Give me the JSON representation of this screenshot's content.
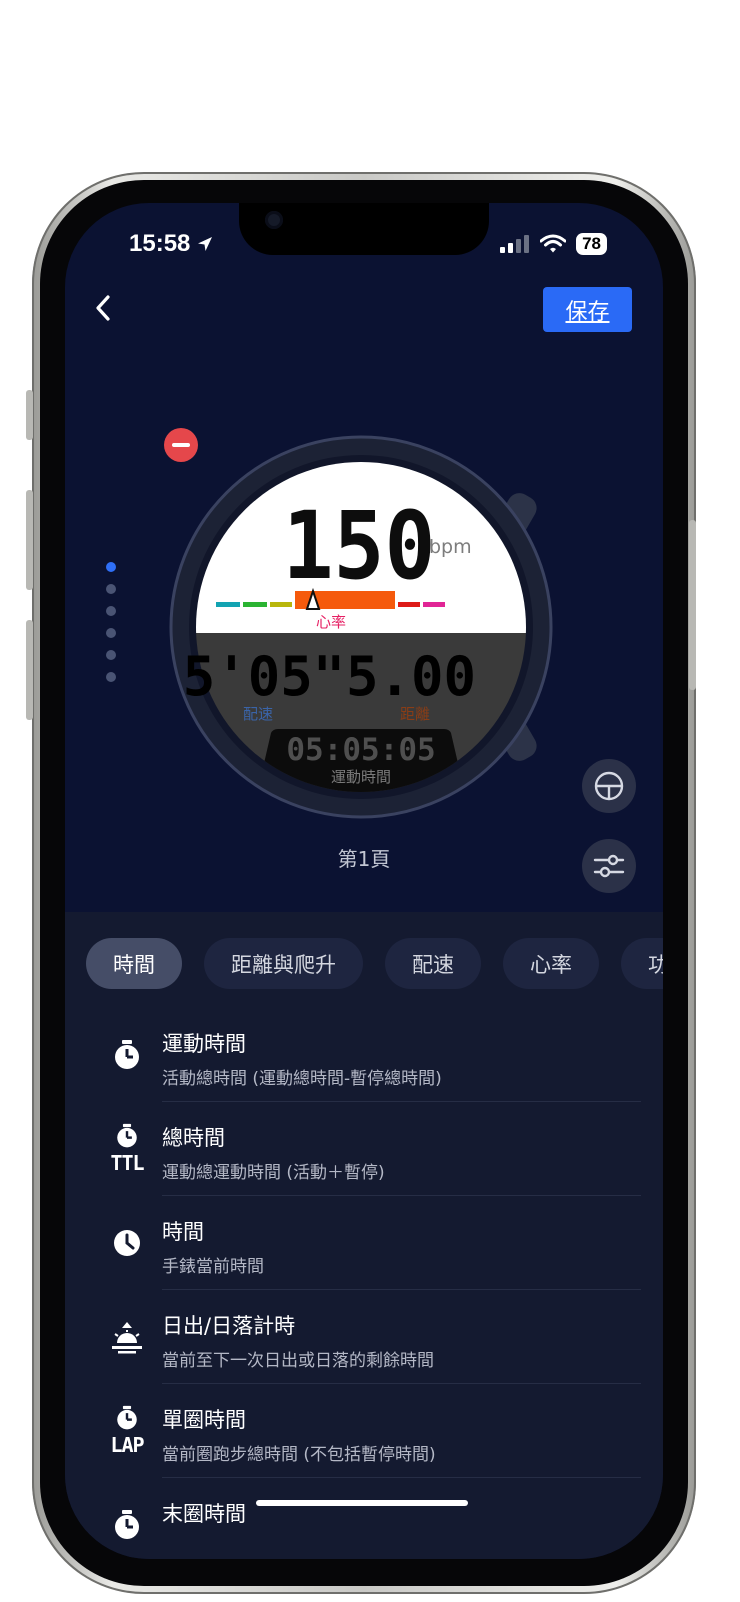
{
  "status_bar": {
    "time": "15:58",
    "battery": "78"
  },
  "header": {
    "save_label": "保存"
  },
  "watch_face": {
    "heart_rate_value": "150",
    "heart_rate_unit": "bpm",
    "heart_rate_label": "心率",
    "pace_value": "5'05\"",
    "pace_label": "配速",
    "distance_value": "5.00",
    "distance_label": "距離",
    "duration_value": "05:05:05",
    "duration_label": "運動時間"
  },
  "pager": {
    "total_pages": 6,
    "current_page": 1,
    "page_label": "第1頁"
  },
  "colors": {
    "accent": "#2A6AF6",
    "background": "#0B1232",
    "panel": "#141A30",
    "hr_zone": "#F55A0C",
    "remove": "#E5474B"
  },
  "category_tabs": [
    {
      "label": "時間",
      "selected": true
    },
    {
      "label": "距離與爬升",
      "selected": false
    },
    {
      "label": "配速",
      "selected": false
    },
    {
      "label": "心率",
      "selected": false
    },
    {
      "label": "功",
      "selected": false
    }
  ],
  "items": [
    {
      "title": "運動時間",
      "subtitle": "活動總時間 (運動總時間-暫停總時間)",
      "icon": "stopwatch-icon",
      "icon_sub": ""
    },
    {
      "title": "總時間",
      "subtitle": "運動總運動時間 (活動＋暫停)",
      "icon": "stopwatch-ttl-icon",
      "icon_sub": "TTL"
    },
    {
      "title": "時間",
      "subtitle": "手錶當前時間",
      "icon": "clock-icon",
      "icon_sub": ""
    },
    {
      "title": "日出/日落計時",
      "subtitle": "當前至下一次日出或日落的剩餘時間",
      "icon": "sunrise-icon",
      "icon_sub": ""
    },
    {
      "title": "單圈時間",
      "subtitle": "當前圈跑步總時間 (不包括暫停時間)",
      "icon": "stopwatch-lap-icon",
      "icon_sub": "LAP"
    },
    {
      "title": "末圈時間",
      "subtitle": "",
      "icon": "stopwatch-icon",
      "icon_sub": ""
    }
  ]
}
